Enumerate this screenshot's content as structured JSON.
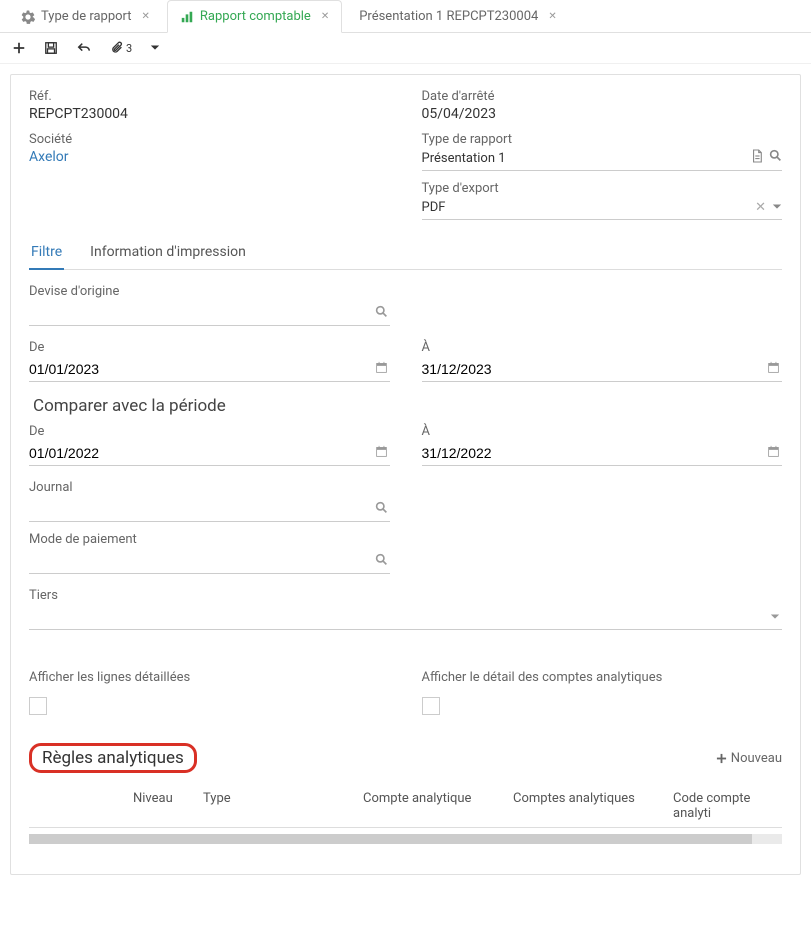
{
  "tabs": [
    {
      "label": "Type de rapport",
      "icon": "gear",
      "active": false
    },
    {
      "label": "Rapport comptable",
      "icon": "chart",
      "active": true
    },
    {
      "label": "Présentation 1 REPCPT230004",
      "icon": "",
      "active": false
    }
  ],
  "toolbar": {
    "attach_count": "3"
  },
  "form": {
    "ref_label": "Réf.",
    "ref_value": "REPCPT230004",
    "company_label": "Société",
    "company_value": "Axelor",
    "closing_date_label": "Date d'arrêté",
    "closing_date_value": "05/04/2023",
    "report_type_label": "Type de rapport",
    "report_type_value": "Présentation 1",
    "export_type_label": "Type d'export",
    "export_type_value": "PDF"
  },
  "subtabs": {
    "filter": "Filtre",
    "print_info": "Information d'impression"
  },
  "filter": {
    "origin_currency_label": "Devise d'origine",
    "from_label": "De",
    "from_value": "01/01/2023",
    "to_label": "À",
    "to_value": "31/12/2023",
    "compare_title": "Comparer avec la période",
    "compare_from_label": "De",
    "compare_from_value": "01/01/2022",
    "compare_to_label": "À",
    "compare_to_value": "31/12/2022",
    "journal_label": "Journal",
    "payment_mode_label": "Mode de paiement",
    "thirdparty_label": "Tiers",
    "show_detailed_lines_label": "Afficher les lignes détaillées",
    "show_analytic_detail_label": "Afficher le détail des comptes analytiques"
  },
  "rules": {
    "title": "Règles analytiques",
    "new_button": "Nouveau",
    "columns": {
      "niveau": "Niveau",
      "type": "Type",
      "analytic_account": "Compte analytique",
      "analytic_accounts": "Comptes analytiques",
      "code": "Code compte analyti"
    }
  }
}
